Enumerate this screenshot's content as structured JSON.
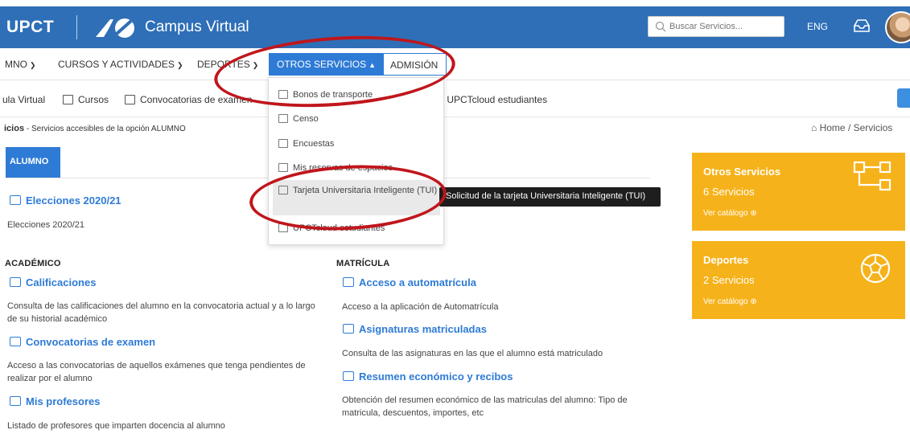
{
  "header": {
    "logo": "UPCT",
    "app_title": "Campus Virtual",
    "search_placeholder": "Buscar Servicios...",
    "language": "ENG",
    "brand_color": "#2e6fb7"
  },
  "nav": {
    "items": [
      {
        "label": "MNO"
      },
      {
        "label": "CURSOS Y ACTIVIDADES"
      },
      {
        "label": "DEPORTES"
      },
      {
        "label": "OTROS SERVICIOS"
      },
      {
        "label": "ADMISIÓN"
      }
    ]
  },
  "quickbar": {
    "items": [
      {
        "label": "ula Virtual"
      },
      {
        "label": "Cursos"
      },
      {
        "label": "Convocatorias de examen"
      },
      {
        "label": ") UPCTcloud estudiantes"
      }
    ]
  },
  "breadcrumb": {
    "left_bold": "icios",
    "left_rest": " - Servicios accesibles de la opción ALUMNO",
    "right": "Home  /  Servicios"
  },
  "main": {
    "tab": "ALUMNO",
    "elecciones": {
      "title": "Elecciones 2020/21",
      "desc": "Elecciones 2020/21"
    },
    "academico": {
      "heading": "ACADÉMICO",
      "items": [
        {
          "title": "Calificaciones",
          "desc": "Consulta de las calificaciones del alumno en la convocatoria actual y a lo largo de su historial académico"
        },
        {
          "title": "Convocatorias de examen",
          "desc": "Acceso a las convocatorias de aquellos exámenes que tenga pendientes de realizar por el alumno"
        },
        {
          "title": "Mis profesores",
          "desc": "Listado de profesores que imparten docencia al alumno"
        }
      ]
    },
    "matricula": {
      "heading": "MATRÍCULA",
      "items": [
        {
          "title": "Acceso a automatrícula",
          "desc": "Acceso a la aplicación de Automatrícula"
        },
        {
          "title": "Asignaturas matriculadas",
          "desc": "Consulta de las asignaturas en las que el alumno está matriculado"
        },
        {
          "title": "Resumen económico y recibos",
          "desc": "Obtención del resumen económico de las matriculas del alumno: Tipo de matricula, descuentos, importes, etc"
        }
      ]
    }
  },
  "cards": [
    {
      "title": "Otros Servicios",
      "count": "6 Servicios",
      "link": "Ver catálogo ⊕",
      "color": "#f6b21a"
    },
    {
      "title": "Deportes",
      "count": "2 Servicios",
      "link": "Ver catálogo ⊕",
      "color": "#f6b21a"
    }
  ],
  "dropdown": {
    "items": [
      {
        "label": "Bonos de transporte"
      },
      {
        "label": "Censo"
      },
      {
        "label": "Encuestas"
      },
      {
        "label": "Mis reservas de espacios"
      },
      {
        "label": "Tarjeta Universitaria Inteligente (TUI)"
      },
      {
        "label": "UPCTcloud estudiantes"
      }
    ]
  },
  "tooltip": "Solicitud de la tarjeta Universitaria Inteligente (TUI)",
  "annotation_color": "#c0161c"
}
